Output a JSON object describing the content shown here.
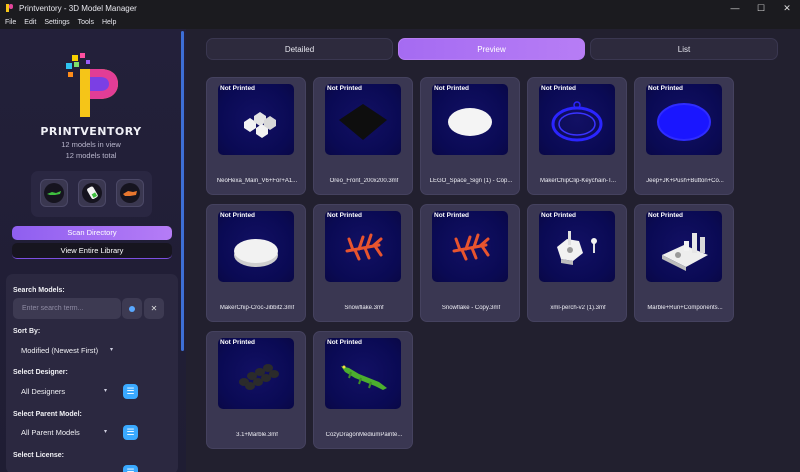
{
  "window": {
    "title": "Printventory - 3D Model Manager",
    "controls": {
      "minimize": "—",
      "maximize": "☐",
      "close": "✕"
    }
  },
  "menu": [
    "File",
    "Edit",
    "Settings",
    "Tools",
    "Help"
  ],
  "sidebar": {
    "brand": "PRINTVENTORY",
    "models_in_view": "12 models in view",
    "models_total": "12 models total",
    "scan_button": "Scan Directory",
    "library_button": "View Entire Library",
    "search_label": "Search Models:",
    "search_placeholder": "Enter search term...",
    "search_clear": "✕",
    "sort_label": "Sort By:",
    "sort_value": "Modified (Newest First)",
    "designer_label": "Select Designer:",
    "designer_value": "All Designers",
    "parent_label": "Select Parent Model:",
    "parent_value": "All Parent Models",
    "license_label": "Select License:",
    "list_icon_glyph": "☰",
    "chevron_glyph": "▾",
    "accent_color": "#a56bf2",
    "link_color": "#3aa9ff"
  },
  "tabs": [
    {
      "label": "Detailed",
      "active": false
    },
    {
      "label": "Preview",
      "active": true
    },
    {
      "label": "List",
      "active": false
    }
  ],
  "models": [
    {
      "status": "Not Printed",
      "name": "NeoHexa_Main_V6+For+A1...",
      "shape": "hexa",
      "color": "#ffffff"
    },
    {
      "status": "Not Printed",
      "name": "Oreo_Front_200x200.3mf",
      "shape": "diamond",
      "color": "#111111"
    },
    {
      "status": "Not Printed",
      "name": "LEGO_Space_Sign (1) - Cop...",
      "shape": "ellipse",
      "color": "#f4f4f4"
    },
    {
      "status": "Not Printed",
      "name": "MakerChipClip-Keychain-T...",
      "shape": "ring",
      "color": "#2b25ff"
    },
    {
      "status": "Not Printed",
      "name": "Jeep+JK+Push+Button+Co...",
      "shape": "disc-blue",
      "color": "#1a16ff"
    },
    {
      "status": "Not Printed",
      "name": "MakerChip-Croc-Jibbitz.3mf",
      "shape": "disc-white",
      "color": "#f0f0f0"
    },
    {
      "status": "Not Printed",
      "name": "Snowflake.3mf",
      "shape": "coral",
      "color": "#e8542e"
    },
    {
      "status": "Not Printed",
      "name": "Snowflake - Copy.3mf",
      "shape": "coral",
      "color": "#e8542e"
    },
    {
      "status": "Not Printed",
      "name": "xml-perch-v2 (1).3mf",
      "shape": "hexbase",
      "color": "#f2f2f2"
    },
    {
      "status": "Not Printed",
      "name": "Marble+Run+Components...",
      "shape": "marble",
      "color": "#eeeeee"
    },
    {
      "status": "Not Printed",
      "name": "3.1+Marble.3mf",
      "shape": "stones",
      "color": "#2a2a2a"
    },
    {
      "status": "Not Printed",
      "name": "CozyDragonMediumPainte...",
      "shape": "dragon",
      "color": "#4caf2e"
    }
  ]
}
